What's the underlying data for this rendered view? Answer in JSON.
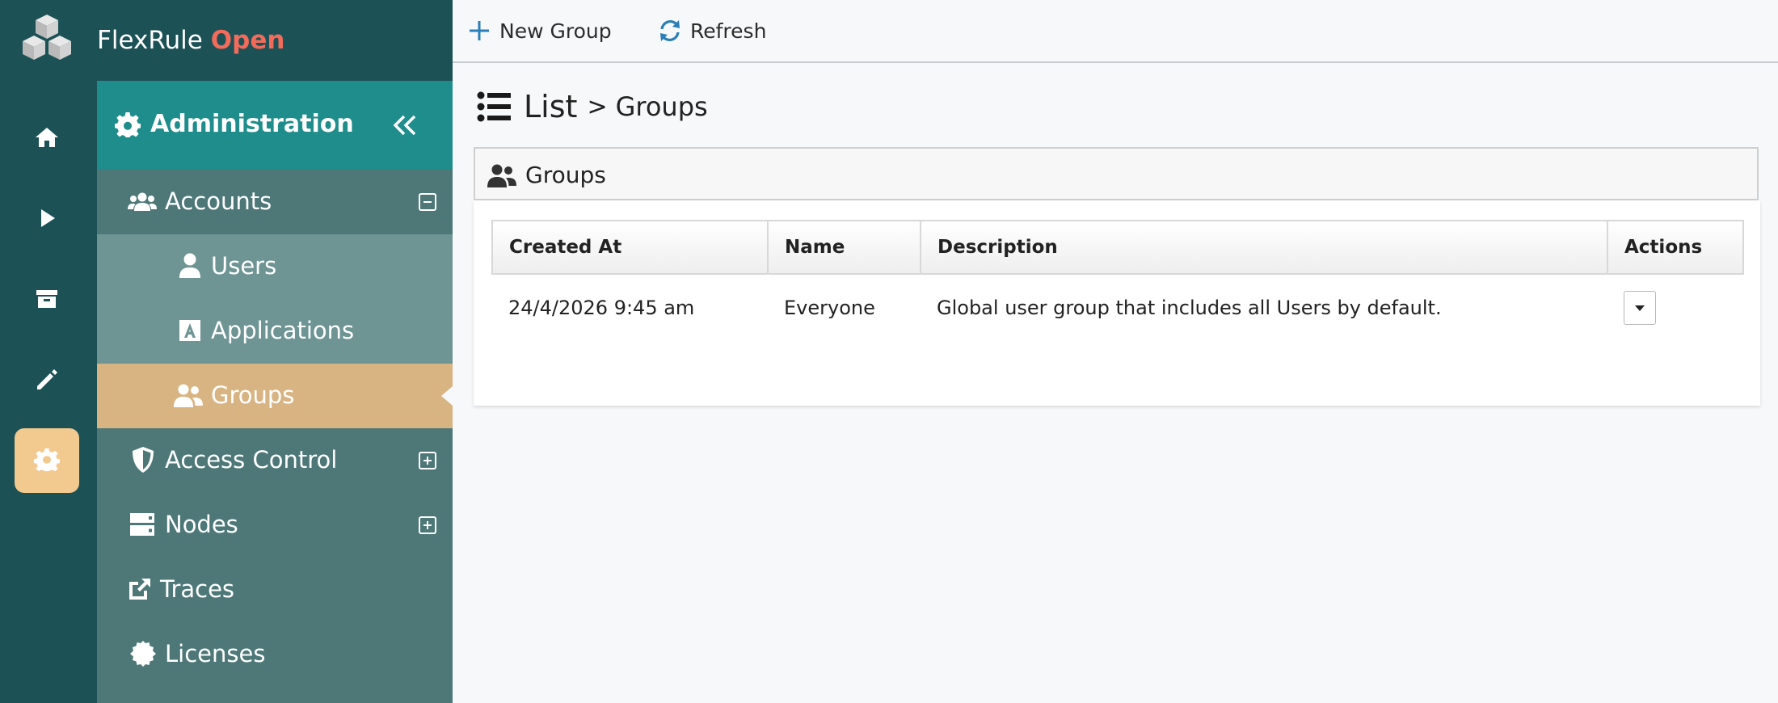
{
  "brand": {
    "name": "FlexRule",
    "accent": "Open"
  },
  "rail": [
    "home-icon",
    "play-icon",
    "archive-icon",
    "pencil-icon",
    "gear-icon"
  ],
  "sidebar": {
    "header": "Administration",
    "items": [
      {
        "label": "Accounts",
        "icon": "users-icon",
        "toggle": "collapse"
      },
      {
        "label": "Users",
        "icon": "user-icon"
      },
      {
        "label": "Applications",
        "icon": "application-icon"
      },
      {
        "label": "Groups",
        "icon": "group-icon",
        "active": true
      },
      {
        "label": "Access Control",
        "icon": "shield-icon",
        "toggle": "expand"
      },
      {
        "label": "Nodes",
        "icon": "server-icon",
        "toggle": "expand"
      },
      {
        "label": "Traces",
        "icon": "external-link-icon"
      },
      {
        "label": "Licenses",
        "icon": "certificate-icon"
      }
    ]
  },
  "toolbar": {
    "new_group": "New Group",
    "refresh": "Refresh"
  },
  "page": {
    "title": "List",
    "separator": ">",
    "subtitle": "Groups"
  },
  "panel": {
    "title": "Groups",
    "columns": [
      "Created At",
      "Name",
      "Description",
      "Actions"
    ],
    "rows": [
      {
        "created_at": "24/4/2026 9:45 am",
        "name": "Everyone",
        "description": "Global user group that includes all Users by default."
      }
    ]
  },
  "colors": {
    "rail": "#1c5156",
    "header_teal": "#1f8d8b",
    "menu": "#4e7878",
    "submenu": "#6e9494",
    "active": "#d8b483",
    "rail_active": "#f2c98e",
    "brand_accent": "#f26b5b",
    "toolbar_icon": "#2b7fb8"
  }
}
